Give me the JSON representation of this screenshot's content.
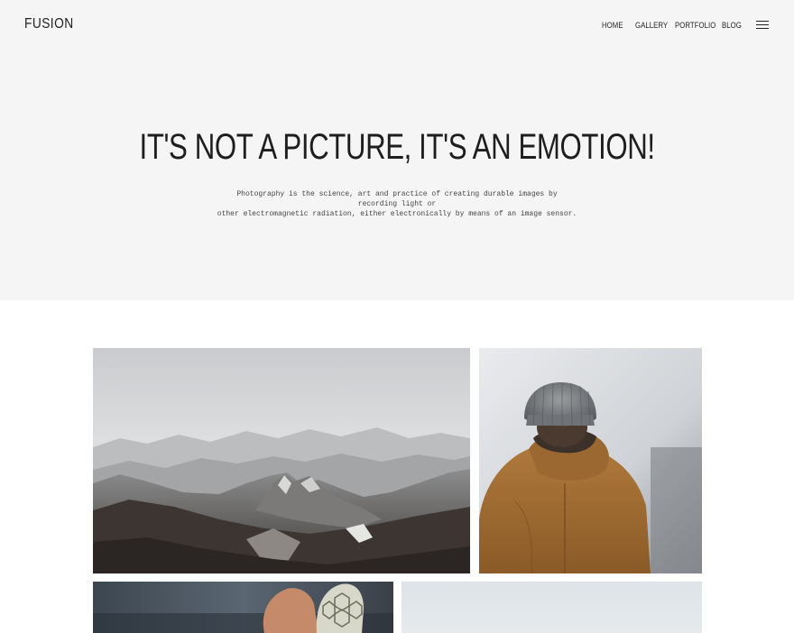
{
  "brand": {
    "logo_text": "FUSION"
  },
  "nav": {
    "items": [
      {
        "label": "HOME"
      },
      {
        "label": "GALLERY"
      },
      {
        "label": "PORTFOLIO"
      },
      {
        "label": "BLOG"
      }
    ],
    "menu_icon": "hamburger-menu-icon"
  },
  "hero": {
    "title": "IT'S NOT A PICTURE, IT'S AN EMOTION!",
    "description_line1": "Photography is the science, art and practice of creating durable images by recording light or",
    "description_line2": "other electromagnetic radiation, either electronically by means of an image sensor.",
    "background_color": "#f5f5f5"
  },
  "gallery": {
    "photos": [
      {
        "subject": "snowy mountain range"
      },
      {
        "subject": "person in knit beanie and brown hooded jacket"
      },
      {
        "subject": "running shoe close-up"
      },
      {
        "subject": "pale misty landscape"
      }
    ]
  }
}
